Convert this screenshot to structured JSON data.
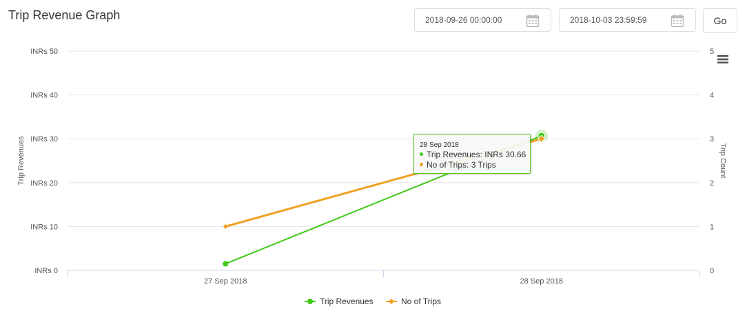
{
  "header": {
    "title": "Trip Revenue Graph"
  },
  "filters": {
    "start_date": "2018-09-26 00:00:00",
    "end_date": "2018-10-03 23:59:59",
    "go_label": "Go"
  },
  "icons": {
    "calendar": "calendar-icon",
    "menu": "hamburger-menu-icon"
  },
  "colors": {
    "revenue": "#3fc816",
    "trips": "#f0a020",
    "grid": "#e6e6e6"
  },
  "chart_data": {
    "type": "line",
    "categories": [
      "27 Sep 2018",
      "28 Sep 2018"
    ],
    "series": [
      {
        "name": "Trip Revenues",
        "axis": "left",
        "values": [
          1.5,
          30.66
        ],
        "marker": "circle"
      },
      {
        "name": "No of Trips",
        "axis": "right",
        "values": [
          1,
          3
        ],
        "marker": "diamond"
      }
    ],
    "y_left": {
      "title": "Trip Revenues",
      "min": 0,
      "max": 50,
      "ticks": [
        0,
        10,
        20,
        30,
        40,
        50
      ],
      "tick_labels": [
        "INRs 0",
        "INRs 10",
        "INRs 20",
        "INRs 30",
        "INRs 40",
        "INRs 50"
      ]
    },
    "y_right": {
      "title": "Trip Count",
      "min": 0,
      "max": 5,
      "ticks": [
        0,
        1,
        2,
        3,
        4,
        5
      ],
      "tick_labels": [
        "0",
        "1",
        "2",
        "3",
        "4",
        "5"
      ]
    },
    "grid": true,
    "legend": {
      "position": "bottom-center",
      "items": [
        "Trip Revenues",
        "No of Trips"
      ]
    },
    "tooltip": {
      "header": "28 Sep 2018",
      "rows": [
        {
          "label": "Trip Revenues",
          "value": "INRs 30.66"
        },
        {
          "label": "No of Trips",
          "value": "3 Trips"
        }
      ]
    }
  }
}
